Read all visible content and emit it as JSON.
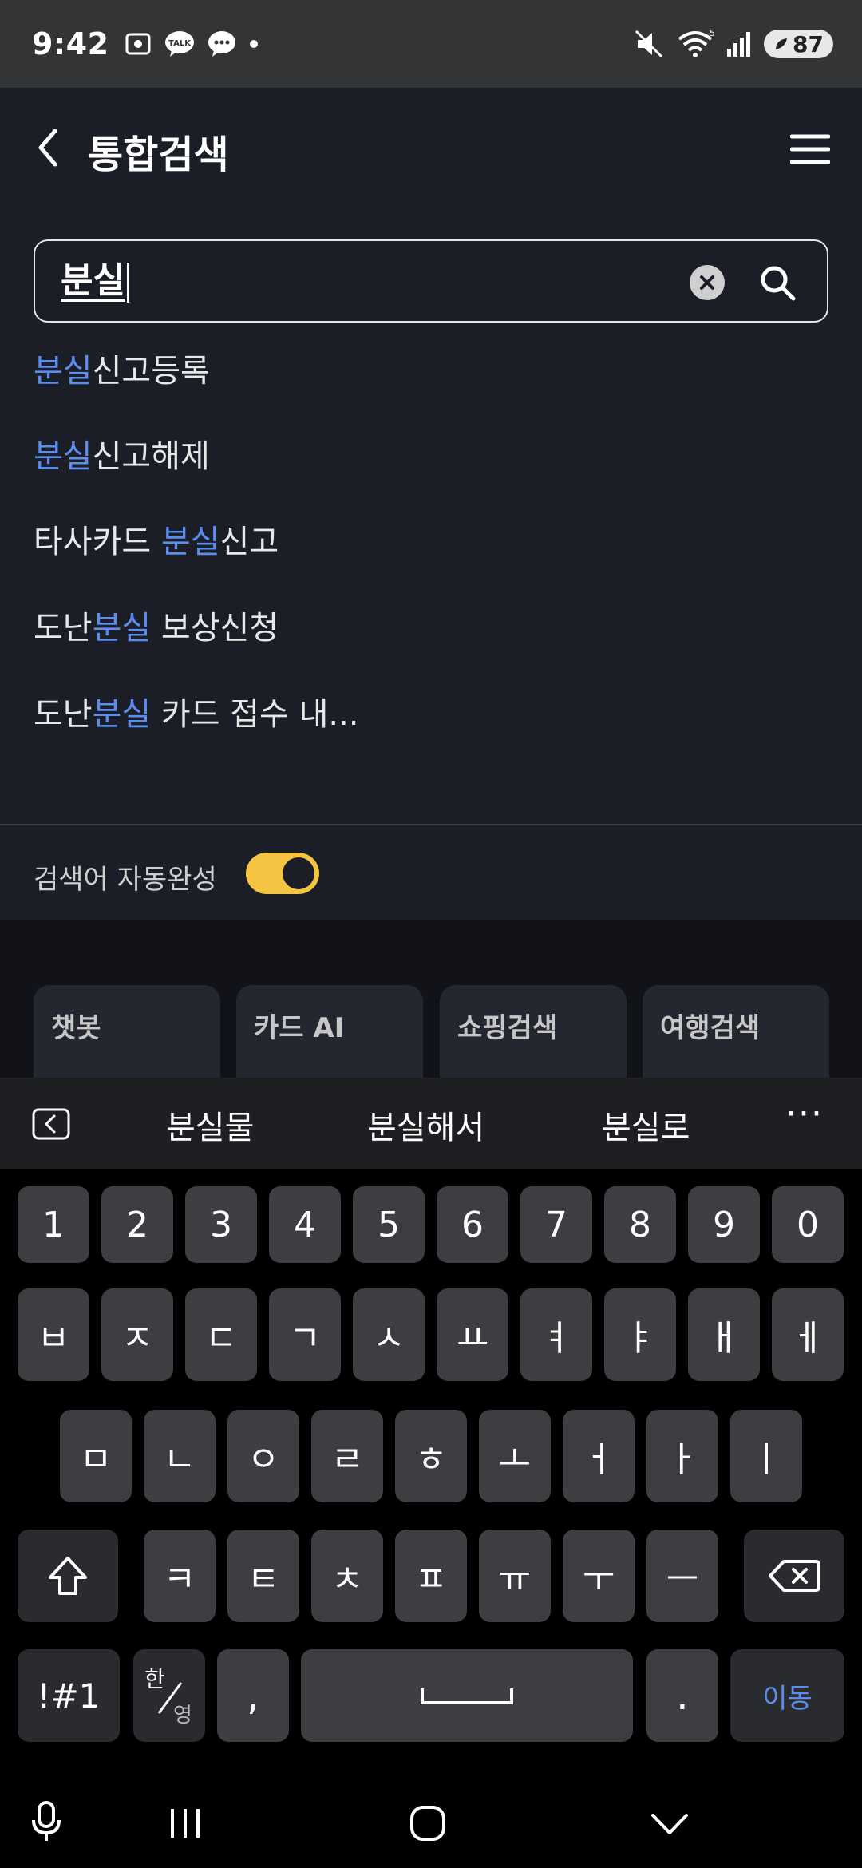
{
  "status_bar": {
    "time": "9:42",
    "battery": "87",
    "talk_badge": "TALK",
    "network": "5"
  },
  "header": {
    "title": "통합검색"
  },
  "search": {
    "value": "분실"
  },
  "suggestions": [
    {
      "pre": "",
      "hl": "분실",
      "post": "신고등록"
    },
    {
      "pre": "",
      "hl": "분실",
      "post": "신고해제"
    },
    {
      "pre": "타사카드 ",
      "hl": "분실",
      "post": "신고"
    },
    {
      "pre": "도난",
      "hl": "분실",
      "post": " 보상신청"
    },
    {
      "pre": "도난",
      "hl": "분실",
      "post": " 카드 접수 내..."
    }
  ],
  "autocomplete": {
    "label": "검색어 자동완성",
    "enabled": true
  },
  "cards": [
    "챗봇",
    "카드 AI",
    "쇼핑검색",
    "여행검색"
  ],
  "keyboard": {
    "predictions": [
      "분실물",
      "분실해서",
      "분실로"
    ],
    "more": "···",
    "row_numbers": [
      "1",
      "2",
      "3",
      "4",
      "5",
      "6",
      "7",
      "8",
      "9",
      "0"
    ],
    "row1": [
      "ㅂ",
      "ㅈ",
      "ㄷ",
      "ㄱ",
      "ㅅ",
      "ㅛ",
      "ㅕ",
      "ㅑ",
      "ㅐ",
      "ㅔ"
    ],
    "row2": [
      "ㅁ",
      "ㄴ",
      "ㅇ",
      "ㄹ",
      "ㅎ",
      "ㅗ",
      "ㅓ",
      "ㅏ",
      "ㅣ"
    ],
    "row3": [
      "ㅋ",
      "ㅌ",
      "ㅊ",
      "ㅍ",
      "ㅠ",
      "ㅜ",
      "ㅡ"
    ],
    "symbols_key": "!#1",
    "lang_key_top": "한",
    "lang_key_bottom": "영",
    "comma_key": ",",
    "period_key": ".",
    "enter_key": "이동"
  },
  "colors": {
    "accent_blue": "#5b8def",
    "toggle_yellow": "#f5c442",
    "app_background": "#1b1e27"
  }
}
